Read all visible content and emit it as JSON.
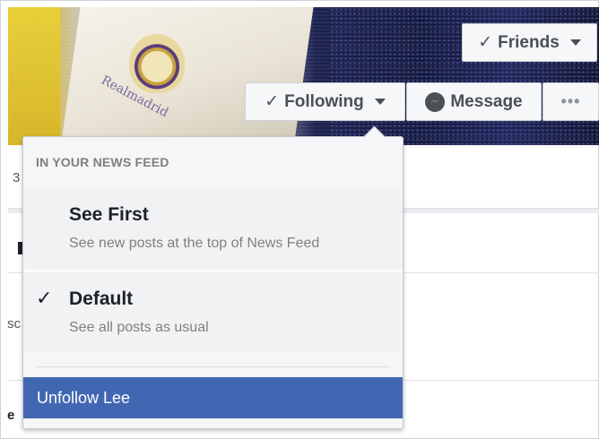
{
  "profile_actions": {
    "friends_label": "Friends",
    "following_label": "Following",
    "message_label": "Message",
    "more_label": "•••"
  },
  "cover": {
    "flag_text": "Realmadrid"
  },
  "background_fragments": {
    "frag1": "3",
    "frag2": "sc",
    "frag3": "e"
  },
  "news_feed_menu": {
    "header": "IN YOUR NEWS FEED",
    "options": [
      {
        "title": "See First",
        "subtitle": "See new posts at the top of News Feed",
        "selected": false
      },
      {
        "title": "Default",
        "subtitle": "See all posts as usual",
        "selected": true
      }
    ],
    "unfollow_label": "Unfollow Lee"
  },
  "colors": {
    "accent": "#4267b2",
    "button_bg": "#f6f7f9",
    "text_dark": "#1d2129",
    "text_muted": "#7f7f7f"
  }
}
